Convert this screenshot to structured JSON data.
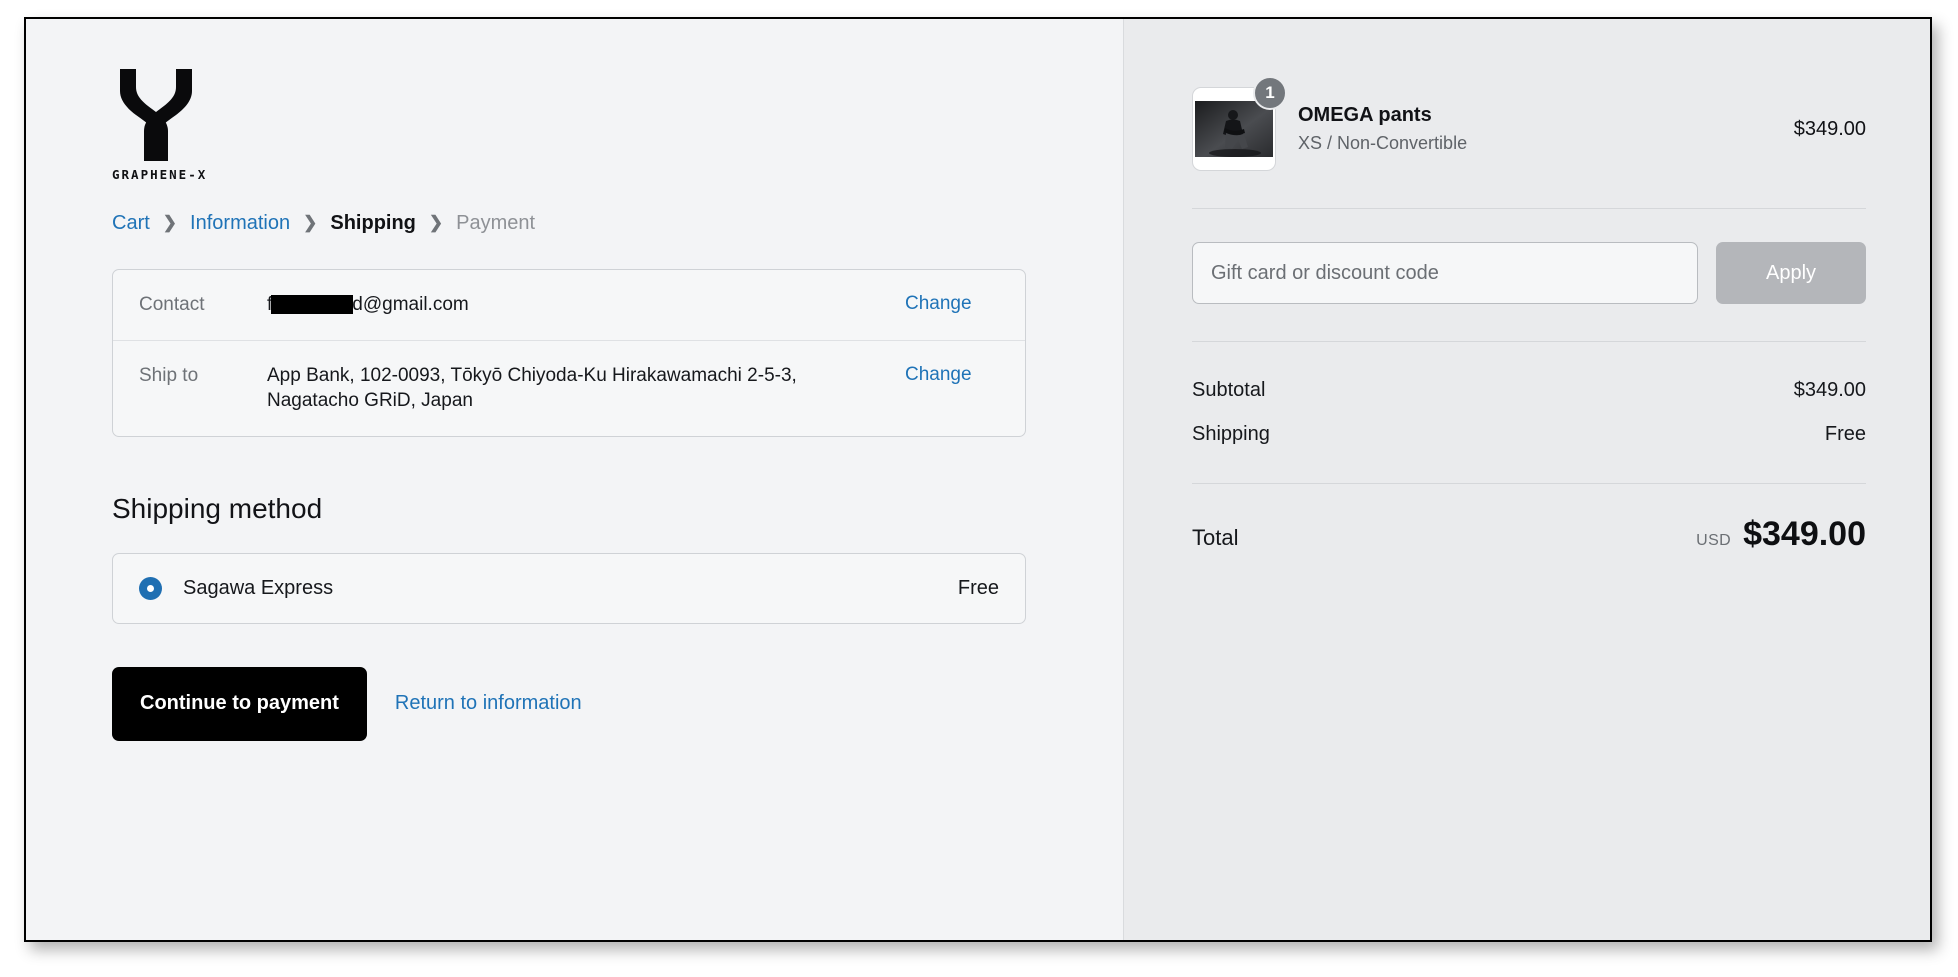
{
  "brand": {
    "wordmark": "GRAPHENE-X",
    "logo_icon": "graphene-x-chromosome-logo"
  },
  "breadcrumb": {
    "separator_icon": "chevron-right-icon",
    "steps": [
      {
        "label": "Cart",
        "state": "link"
      },
      {
        "label": "Information",
        "state": "link"
      },
      {
        "label": "Shipping",
        "state": "current"
      },
      {
        "label": "Payment",
        "state": "upcoming"
      }
    ]
  },
  "review": {
    "contact": {
      "label": "Contact",
      "value_prefix": "f",
      "value_suffix": "d@gmail.com",
      "change_label": "Change"
    },
    "ship_to": {
      "label": "Ship to",
      "value": "App Bank, 102-0093, Tōkyō Chiyoda-Ku Hirakawamachi 2-5-3, Nagatacho GRiD, Japan",
      "change_label": "Change"
    }
  },
  "shipping_method": {
    "heading": "Shipping method",
    "option": {
      "name": "Sagawa Express",
      "price": "Free",
      "selected": true,
      "radio_icon": "radio-selected-icon"
    }
  },
  "actions": {
    "continue_label": "Continue to payment",
    "return_label": "Return to information"
  },
  "order_summary": {
    "item": {
      "title": "OMEGA pants",
      "variant": "XS / Non-Convertible",
      "price": "$349.00",
      "quantity": "1",
      "thumbnail_icon": "product-photo-omega-pants"
    },
    "discount": {
      "placeholder": "Gift card or discount code",
      "value": "",
      "apply_label": "Apply"
    },
    "totals": [
      {
        "label": "Subtotal",
        "value": "$349.00"
      },
      {
        "label": "Shipping",
        "value": "Free"
      }
    ],
    "grand_total": {
      "label": "Total",
      "currency": "USD",
      "amount": "$349.00"
    }
  },
  "colors": {
    "link_blue": "#1f73b7",
    "radio_blue": "#1f6fb2",
    "primary_button": "#000000",
    "apply_disabled": "#b4b6ba",
    "left_panel_bg": "#f3f4f6",
    "right_panel_bg": "#eaebed"
  }
}
